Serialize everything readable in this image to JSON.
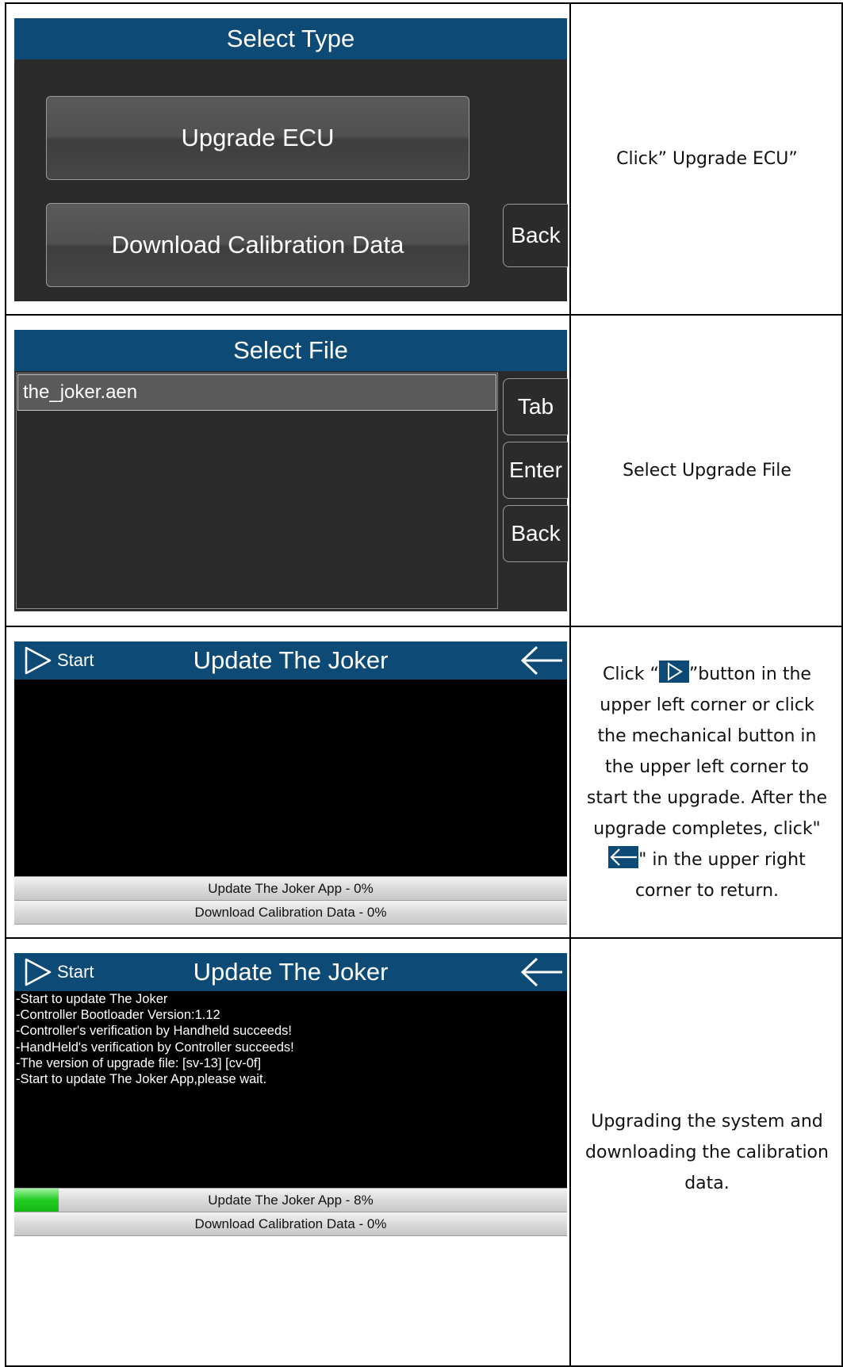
{
  "rows": [
    {
      "screen": {
        "title": "Select Type",
        "buttons": [
          "Upgrade ECU",
          "Download Calibration Data"
        ],
        "back_label": "Back"
      },
      "instruction": "Click” Upgrade ECU”"
    },
    {
      "screen": {
        "title": "Select File",
        "files": [
          "the_joker.aen"
        ],
        "tab_label": "Tab",
        "enter_label": "Enter",
        "back_label": "Back"
      },
      "instruction": "Select Upgrade File"
    },
    {
      "screen": {
        "start_label": "Start",
        "title": "Update The Joker",
        "progress": [
          {
            "label": "Update The Joker App - 0%",
            "value": 0
          },
          {
            "label": "Download Calibration Data - 0%",
            "value": 0
          }
        ]
      },
      "instruction": {
        "part1": "Click “",
        "part2": "”button in the upper left corner or click the mechanical button in the upper left corner to start the upgrade. After the upgrade completes, click\"",
        "part3": "\" in the upper right corner to return."
      }
    },
    {
      "screen": {
        "start_label": "Start",
        "title": "Update The Joker",
        "log": [
          "-Start to update The Joker",
          "-Controller Bootloader Version:1.12",
          "-Controller's verification by Handheld succeeds!",
          "-HandHeld's verification by Controller succeeds!",
          "-The version of upgrade file: [sv-13] [cv-0f]",
          "-Start to update The Joker App,please wait."
        ],
        "progress": [
          {
            "label": "Update The Joker App - 8%",
            "value": 0.08
          },
          {
            "label": "Download Calibration Data - 0%",
            "value": 0
          }
        ]
      },
      "instruction": "Upgrading the system and downloading the calibration data."
    }
  ],
  "colors": {
    "title_bar": "#0d4a76",
    "screen_bg": "#2b2b2b",
    "progress_fill": "#22cc22"
  },
  "icons": [
    "play-triangle-icon",
    "back-arrow-icon"
  ]
}
